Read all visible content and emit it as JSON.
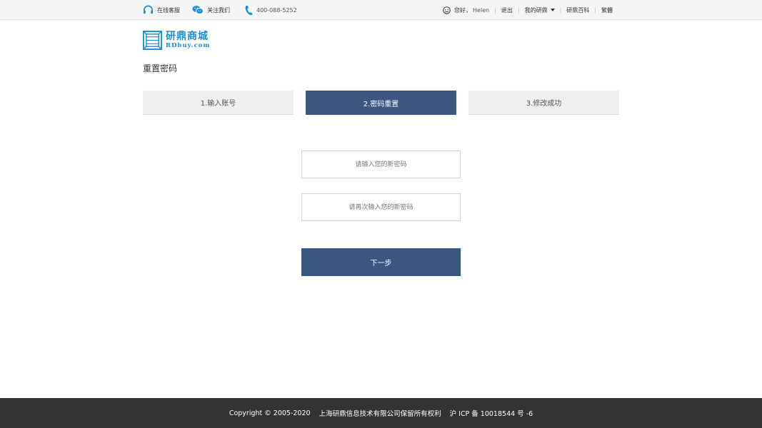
{
  "topbar": {
    "service_label": "在线客服",
    "follow_label": "关注我们",
    "phone": "400-088-5252",
    "greeting": "您好，",
    "username": "Helen",
    "logout": "退出",
    "my_account": "我的研鼎",
    "encyclopedia": "研鼎百科",
    "traditional": "繁體",
    "separator": "|"
  },
  "logo": {
    "cn": "研鼎商城",
    "en": "RDbuy.com"
  },
  "page": {
    "title": "重置密码"
  },
  "steps": [
    {
      "label": "1.输入账号",
      "active": false
    },
    {
      "label": "2.密码重置",
      "active": true
    },
    {
      "label": "3.修改成功",
      "active": false
    }
  ],
  "form": {
    "new_password": {
      "value": "",
      "placeholder": "请输入您的新密码"
    },
    "confirm_password": {
      "value": "",
      "placeholder": "请再次输入您的新密码"
    },
    "next_label": "下一步"
  },
  "footer": {
    "copyright": "Copyright © 2005-2020",
    "company": "上海研鼎信息技术有限公司保留所有权利",
    "icp": "沪 ICP 备 10018544 号 -6"
  },
  "colors": {
    "accent": "#3b5680",
    "brand_blue": "#1b8ed6",
    "footer_bg": "#333333",
    "step_inactive": "#efefef"
  }
}
